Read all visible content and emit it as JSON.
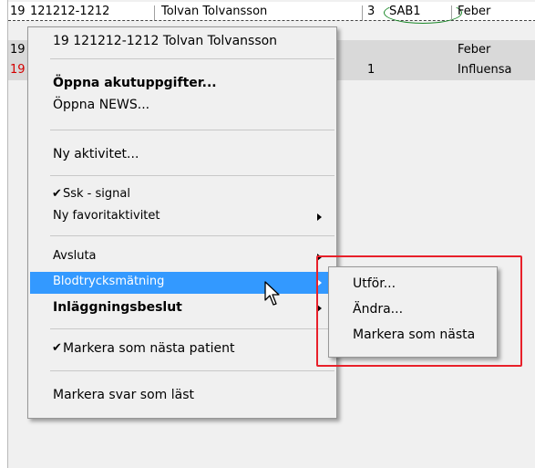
{
  "list": {
    "rows": [
      {
        "nr": "19",
        "pnr": "121212-1212",
        "name": "Tolvan Tolvansson",
        "count": "3",
        "tag": "SAB1",
        "diag": "Feber"
      },
      {
        "nr": "19",
        "diag": "Feber"
      },
      {
        "nr": "19",
        "count": "1",
        "diag": "Influensa"
      }
    ]
  },
  "context_menu": {
    "header": "19  121212-1212 Tolvan Tolvansson",
    "items": {
      "open_urgent": "Öppna akutuppgifter...",
      "open_news": "Öppna NEWS...",
      "new_activity": "Ny aktivitet...",
      "nurse_signal": "Ssk - signal",
      "new_favorite": "Ny favoritaktivitet",
      "finish": "Avsluta",
      "blood_pressure": "Blodtrycksmätning",
      "admission": "Inläggningsbeslut",
      "mark_next_patient": "Markera som nästa patient",
      "mark_read": "Markera svar som läst"
    }
  },
  "submenu": {
    "perform": "Utför...",
    "edit": "Ändra...",
    "mark_next": "Markera som nästa"
  },
  "colors": {
    "highlight": "#3399ff",
    "annotation": "#e8202a",
    "red_text": "#d40000",
    "oval": "#1c8a2a"
  },
  "icons": {
    "check": "checkmark-icon",
    "submenu_arrow": "chevron-right-icon",
    "cursor": "mouse-pointer-icon"
  }
}
